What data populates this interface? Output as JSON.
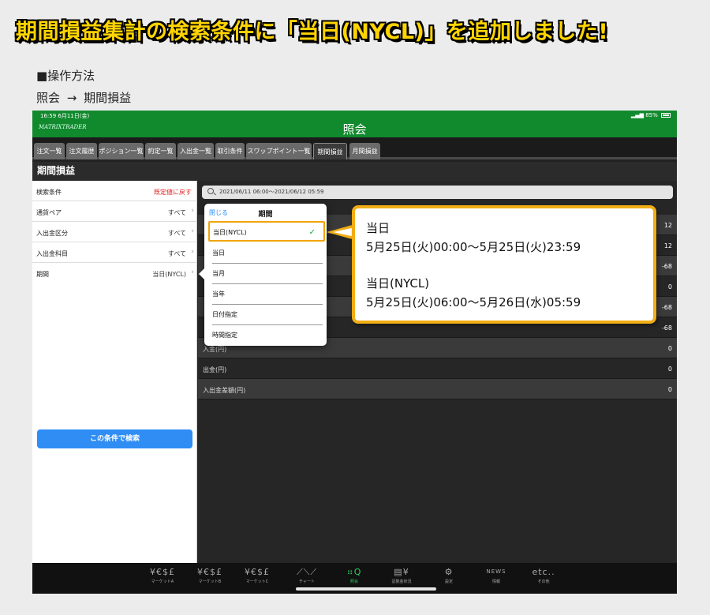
{
  "headline": "期間損益集計の検索条件に「当日(NYCL)」を追加しました!",
  "operation": {
    "title": "■操作方法",
    "path": "照会 → 期間損益"
  },
  "status": {
    "time": "16:59 6月11日(金)",
    "battery": "85%"
  },
  "app": {
    "logo": "MATRIXTRADER",
    "title": "照会"
  },
  "tabs": [
    "注文一覧",
    "注文履歴",
    "ポジション一覧",
    "約定一覧",
    "入出金一覧",
    "取引条件",
    "スワップポイント一覧",
    "期間損益",
    "月間損益"
  ],
  "active_tab": "期間損益",
  "section_title": "期間損益",
  "left": {
    "header_label": "検索条件",
    "reset_label": "既定値に戻す",
    "rows": [
      {
        "label": "通貨ペア",
        "value": "すべて"
      },
      {
        "label": "入出金区分",
        "value": "すべて"
      },
      {
        "label": "入出金科目",
        "value": "すべて"
      },
      {
        "label": "期間",
        "value": "当日(NYCL)"
      }
    ],
    "search_button": "この条件で検索"
  },
  "right": {
    "search_text": "2021/06/11 06:00〜2021/06/12 05:59",
    "rows": [
      {
        "label": "",
        "value": "12"
      },
      {
        "label": "",
        "value": "12"
      },
      {
        "label": "",
        "value": "-68"
      },
      {
        "label": "",
        "value": "0"
      },
      {
        "label": "",
        "value": "-68"
      },
      {
        "label": "",
        "value": "-68"
      },
      {
        "label": "入金(円)",
        "value": "0"
      },
      {
        "label": "出金(円)",
        "value": "0"
      },
      {
        "label": "入出金差額(円)",
        "value": "0"
      }
    ]
  },
  "popover": {
    "close_label": "閉じる",
    "title": "期間",
    "items": [
      "当日(NYCL)",
      "当日",
      "当月",
      "当年",
      "日付指定",
      "時間指定"
    ],
    "selected": "当日(NYCL)"
  },
  "callout": {
    "line1_title": "当日",
    "line1_range": "5月25日(火)00:00〜5月25日(火)23:59",
    "line2_title": "当日(NYCL)",
    "line2_range": "5月25日(火)06:00〜5月26日(水)05:59"
  },
  "bottom_nav": [
    {
      "glyph": "¥€$£",
      "caption": "マーケットA",
      "icon": "currency-icon"
    },
    {
      "glyph": "¥€$£",
      "caption": "マーケットB",
      "icon": "currency-icon"
    },
    {
      "glyph": "¥€$£",
      "caption": "マーケットC",
      "icon": "currency-icon"
    },
    {
      "glyph": "⟋⟍⟋",
      "caption": "チャート",
      "icon": "chart-icon"
    },
    {
      "glyph": "⠶Q",
      "caption": "照会",
      "icon": "inquiry-icon"
    },
    {
      "glyph": "▤¥",
      "caption": "証拠金状況",
      "icon": "margin-icon"
    },
    {
      "glyph": "⚙",
      "caption": "設定",
      "icon": "settings-icon"
    },
    {
      "glyph": "NEWS",
      "caption": "情報",
      "icon": "news-icon"
    },
    {
      "glyph": "etc..",
      "caption": "その他",
      "icon": "etc-icon"
    }
  ],
  "colors": {
    "status_green": "#118a2e",
    "accent_blue": "#2f8df4",
    "callout_border": "#f1ad14",
    "headline": "#ffd400",
    "reset_red": "#e02020"
  }
}
